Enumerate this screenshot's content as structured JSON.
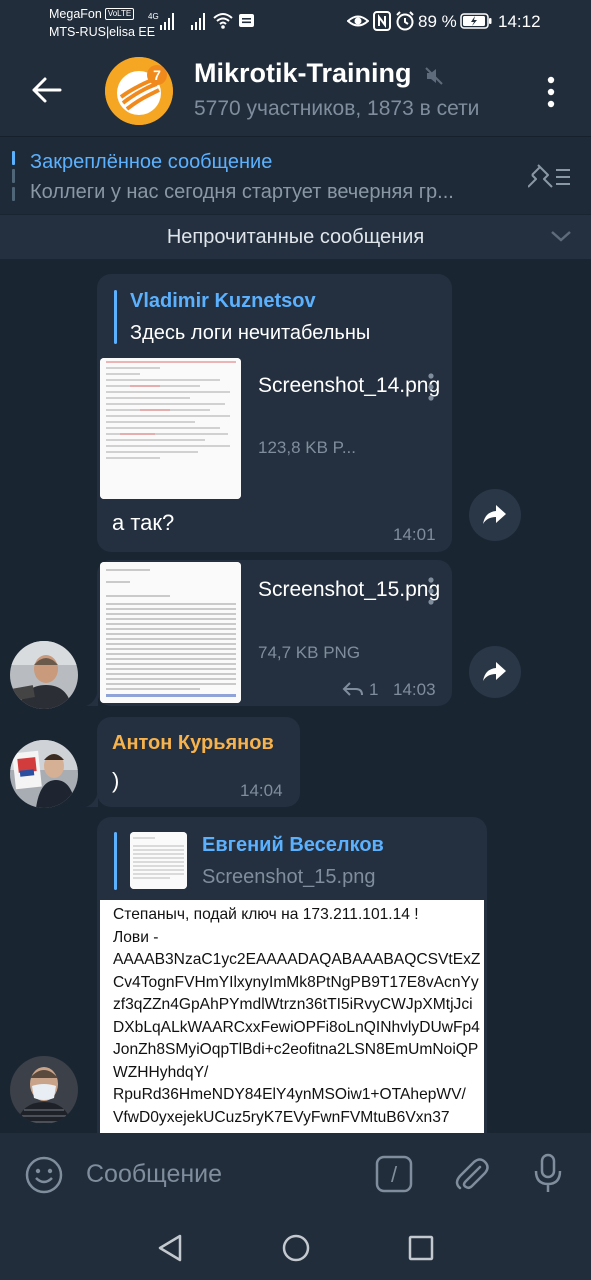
{
  "status_bar": {
    "carrier1": "MegaFon",
    "volte": "VoLTE",
    "carrier2": "MTS-RUS|elisa EE",
    "network": "4G",
    "battery": "89 %",
    "time": "14:12"
  },
  "header": {
    "title": "Mikrotik-Training",
    "subtitle": "5770 участников, 1873 в сети",
    "avatar_badge": "7"
  },
  "pinned": {
    "title": "Закреплённое сообщение",
    "text": "Коллеги у нас сегодня стартует вечерняя гр..."
  },
  "unread": {
    "label": "Непрочитанные сообщения"
  },
  "messages": [
    {
      "reply_name": "Vladimir Kuznetsov",
      "reply_text": "Здесь логи нечитабельны",
      "file_name": "Screenshot_14.png",
      "file_size": "123,8 KB P...",
      "text": "а так?",
      "time": "14:01"
    },
    {
      "file_name": "Screenshot_15.png",
      "file_size": "74,7 KB PNG",
      "replies": "1",
      "time": "14:03"
    },
    {
      "sender": "Антон Курьянов",
      "text": ")",
      "time": "14:04"
    },
    {
      "reply_name": "Евгений Веселков",
      "reply_text": "Screenshot_15.png",
      "image_text": "Степаныч, подай ключ на 173.211.101.14 !\nЛови -\nAAAAB3NzaC1yc2EAAAADAQABAAABAQCSVtExZCv4TognFVHmYIlxynyImMk8PtNgPB9T17E8vAcnYyzf3qZZn4GpAhPYmdlWtrzn36tTI5iRvyCWJpXMtjJciDXbLqALkWAARCxxFewiOPFi8oLnQINhvlyDUwFp4JonZh8SMyiOqpTlBdi+c2eofitna2LSN8EmUmNoiQPWZHHyhdqY/\nRpuRd36HmeNDY84ElY4ynMSOiw1+OTAhepWV/\nVfwD0yxejekUCuz5ryK7EVyFwnFVMtuB6Vxn37"
    }
  ],
  "input": {
    "placeholder": "Сообщение",
    "cmd_label": "/"
  },
  "colors": {
    "accent": "#5cb1ff",
    "sender": "#f7b24c",
    "bubble": "#24303f",
    "background": "#1a2532"
  }
}
